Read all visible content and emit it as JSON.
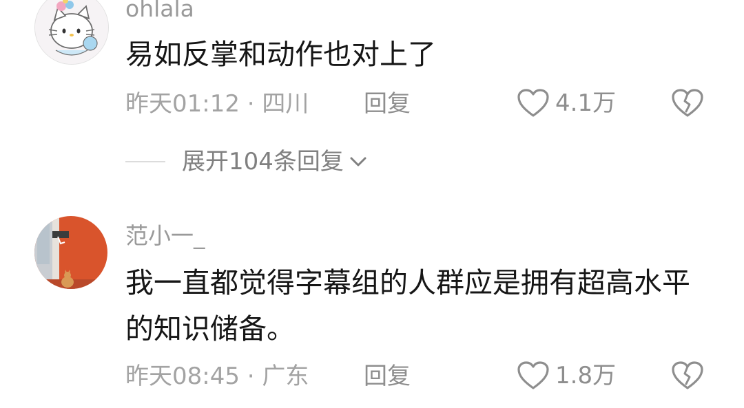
{
  "comments": [
    {
      "username": "ohlala",
      "text": "易如反掌和动作也对上了",
      "time_location": "昨天01:12 · 四川",
      "reply_label": "回复",
      "likes": "4.1万",
      "expand_label": "展开104条回复"
    },
    {
      "username": "范小一_",
      "text": "我一直都觉得字幕组的人群应是拥有超高水平的知识储备。",
      "time_location": "昨天08:45 · 广东",
      "reply_label": "回复",
      "likes": "1.8万"
    }
  ],
  "colors": {
    "text_primary": "#161616",
    "text_secondary": "#a3a3a3",
    "icon": "#8e8e8e",
    "avatar2_bg": "#d9542c"
  }
}
